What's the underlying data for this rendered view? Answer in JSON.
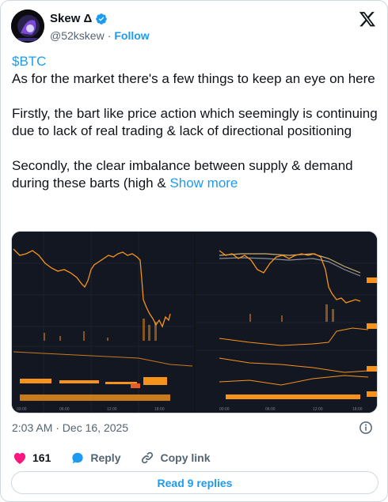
{
  "author": {
    "name": "Skew Δ",
    "handle": "@52kskew",
    "separator": "·",
    "follow_label": "Follow"
  },
  "tweet": {
    "cashtag": "$BTC",
    "line1": "As for the market there's a few things to keep an eye on here",
    "para2": "Firstly, the bart like price action which seemingly is continuing due to lack of real trading & lack of directional positioning",
    "para3": "Secondly, the clear imbalance between supply & demand during these barts (high & ",
    "show_more": "Show more"
  },
  "meta": {
    "timestamp": "2:03 AM · Dec 16, 2025"
  },
  "actions": {
    "likes_count": "161",
    "reply_label": "Reply",
    "copy_link_label": "Copy link"
  },
  "footer": {
    "read_replies_label": "Read 9 replies"
  },
  "colors": {
    "accent": "#1d9bf0",
    "like": "#f91880",
    "chart_price": "#f7931a",
    "chart_bg": "#121418"
  },
  "icons": [
    "verified-badge-icon",
    "x-logo-icon",
    "info-icon",
    "heart-icon",
    "reply-bubble-icon",
    "link-icon"
  ]
}
